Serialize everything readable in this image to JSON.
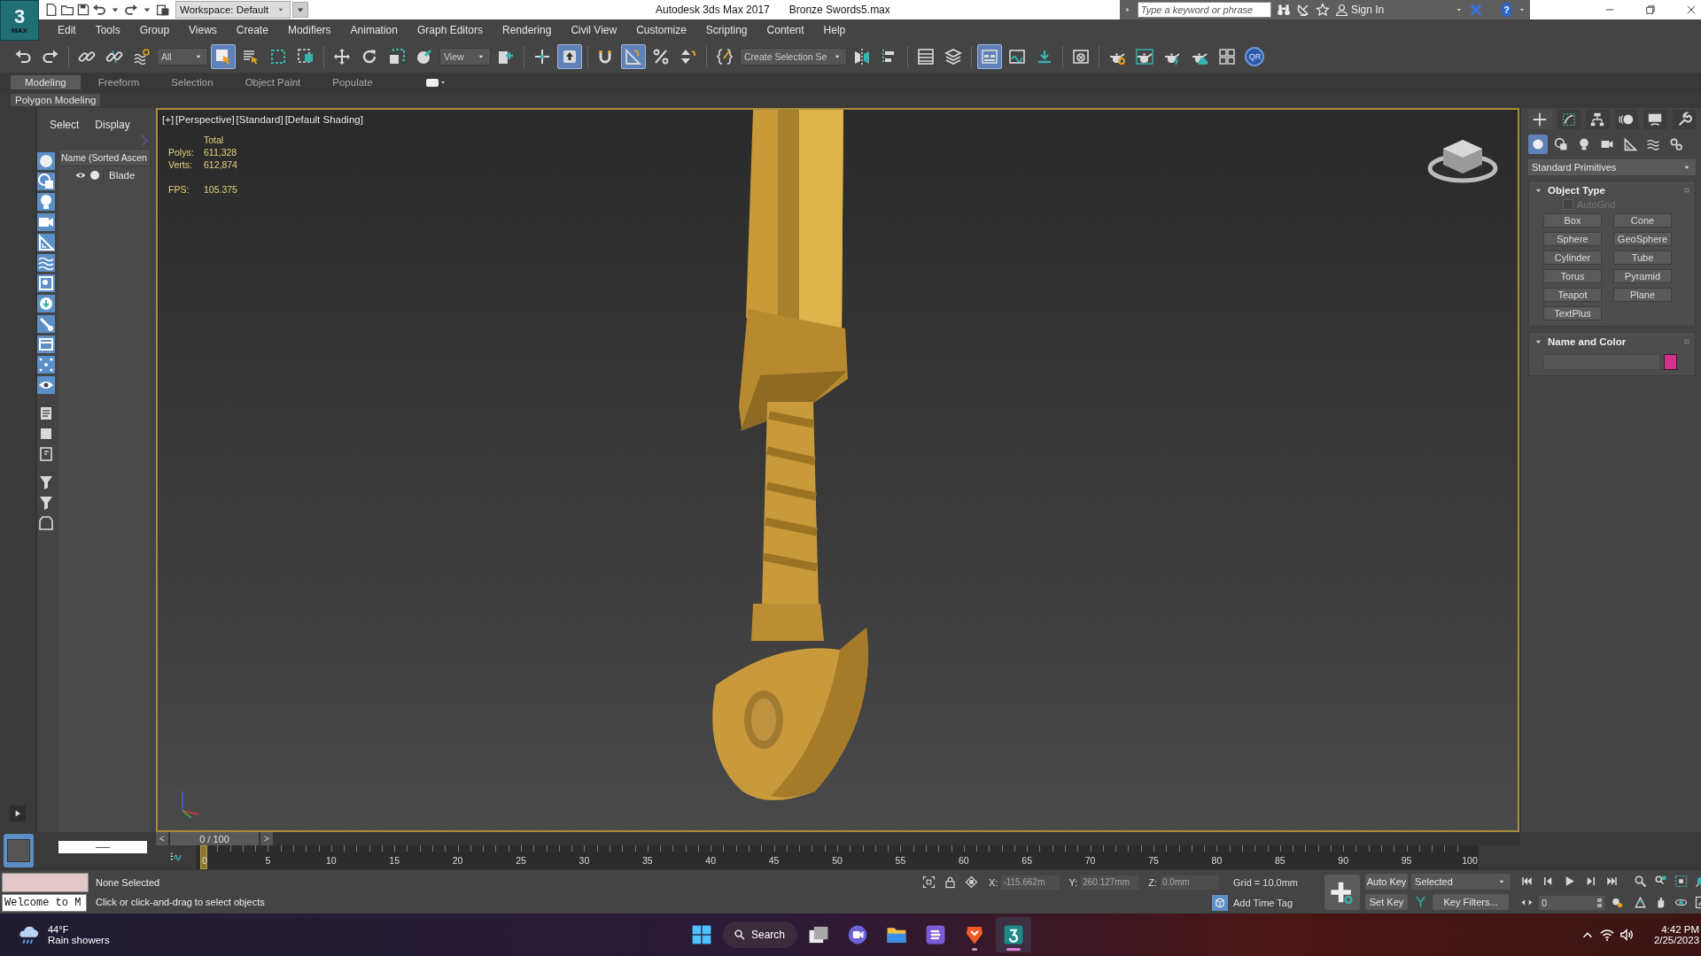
{
  "title_bar": {
    "logo_numeral": "3",
    "logo_label": "MAX",
    "workspace": "Workspace: Default",
    "app_title": "Autodesk 3ds Max 2017",
    "file_name": "Bronze Swords5.max"
  },
  "info_center": {
    "search_placeholder": "Type a keyword or phrase",
    "sign_in": "Sign In",
    "help": "?"
  },
  "menu": [
    "Edit",
    "Tools",
    "Group",
    "Views",
    "Create",
    "Modifiers",
    "Animation",
    "Graph Editors",
    "Rendering",
    "Civil View",
    "Customize",
    "Scripting",
    "Content",
    "Help"
  ],
  "main_toolbar": [
    {
      "kind": "undo",
      "pressed": false
    },
    {
      "kind": "redo",
      "pressed": false
    },
    {
      "kind": "sep"
    },
    {
      "kind": "link",
      "pressed": false
    },
    {
      "kind": "unlink",
      "pressed": false
    },
    {
      "kind": "bind",
      "pressed": false
    },
    {
      "kind": "dropdown",
      "value": "All"
    },
    {
      "kind": "selectobj",
      "pressed": true
    },
    {
      "kind": "selectname",
      "pressed": false
    },
    {
      "kind": "rectregion",
      "pressed": false
    },
    {
      "kind": "window",
      "pressed": false
    },
    {
      "kind": "sep"
    },
    {
      "kind": "move",
      "pressed": false
    },
    {
      "kind": "rotate",
      "pressed": false
    },
    {
      "kind": "scale",
      "pressed": false
    },
    {
      "kind": "place",
      "pressed": false
    },
    {
      "kind": "dropdown",
      "value": "View"
    },
    {
      "kind": "pivot",
      "pressed": false
    },
    {
      "kind": "sep"
    },
    {
      "kind": "manip",
      "pressed": false
    },
    {
      "kind": "uparrow",
      "pressed": true
    },
    {
      "kind": "sep"
    },
    {
      "kind": "snap",
      "pressed": false
    },
    {
      "kind": "angle",
      "pressed": true
    },
    {
      "kind": "percent",
      "pressed": false
    },
    {
      "kind": "spinner",
      "pressed": false
    },
    {
      "kind": "sep"
    },
    {
      "kind": "editsel",
      "pressed": false
    },
    {
      "kind": "dropdown",
      "value": "Create Selection Se"
    },
    {
      "kind": "mirror",
      "pressed": false
    },
    {
      "kind": "align",
      "pressed": false
    },
    {
      "kind": "sep"
    },
    {
      "kind": "sceneexp",
      "pressed": false
    },
    {
      "kind": "layerexp",
      "pressed": false
    },
    {
      "kind": "sep"
    },
    {
      "kind": "ribbon",
      "pressed": true
    },
    {
      "kind": "curve",
      "pressed": false
    },
    {
      "kind": "schematic",
      "pressed": false
    },
    {
      "kind": "sep"
    },
    {
      "kind": "material",
      "pressed": false
    },
    {
      "kind": "sep"
    },
    {
      "kind": "rendersetup",
      "pressed": false
    },
    {
      "kind": "renderframe",
      "pressed": false
    },
    {
      "kind": "render",
      "pressed": false
    },
    {
      "kind": "cloud",
      "pressed": false
    },
    {
      "kind": "a360",
      "pressed": false
    },
    {
      "kind": "qr",
      "label": "QR",
      "pressed": false
    }
  ],
  "ribbon": {
    "tabs": [
      {
        "label": "Modeling",
        "selected": true
      },
      {
        "label": "Freeform",
        "selected": false
      },
      {
        "label": "Selection",
        "selected": false
      },
      {
        "label": "Object Paint",
        "selected": false
      },
      {
        "label": "Populate",
        "selected": false
      }
    ],
    "panel": "Polygon Modeling"
  },
  "scene_explorer": {
    "tabs": [
      "Select",
      "Display"
    ],
    "column": "Name (Sorted Ascen",
    "items": [
      {
        "name": "Blade",
        "visible": true
      }
    ]
  },
  "viewport": {
    "active": true,
    "labels": [
      "[+]",
      "[Perspective]",
      "[Standard]",
      "[Default Shading]"
    ],
    "stats": {
      "header": "Total",
      "rows": [
        {
          "label": "Polys:",
          "value": "611,328"
        },
        {
          "label": "Verts:",
          "value": "612,874"
        }
      ],
      "fps_label": "FPS:",
      "fps": "105.375"
    }
  },
  "command_panel": {
    "tabs": [
      {
        "kind": "create",
        "selected": true
      },
      {
        "kind": "modify",
        "selected": false
      },
      {
        "kind": "hierarchy",
        "selected": false
      },
      {
        "kind": "motion",
        "selected": false
      },
      {
        "kind": "display",
        "selected": false
      },
      {
        "kind": "utilities",
        "selected": false
      }
    ],
    "categories": [
      {
        "kind": "geometry",
        "selected": true
      },
      {
        "kind": "shapes",
        "selected": false
      },
      {
        "kind": "lights",
        "selected": false
      },
      {
        "kind": "cameras",
        "selected": false
      },
      {
        "kind": "helpers",
        "selected": false
      },
      {
        "kind": "spacewarps",
        "selected": false
      },
      {
        "kind": "systems",
        "selected": false
      }
    ],
    "dropdown": "Standard Primitives",
    "object_type": {
      "title": "Object Type",
      "expanded": true,
      "autogrid": {
        "label": "AutoGrid",
        "checked": false,
        "disabled": true
      },
      "buttons": [
        "Box",
        "Cone",
        "Sphere",
        "GeoSphere",
        "Cylinder",
        "Tube",
        "Torus",
        "Pyramid",
        "Teapot",
        "Plane",
        "TextPlus"
      ]
    },
    "name_and_color": {
      "title": "Name and Color",
      "expanded": true,
      "color": "#d4308c"
    }
  },
  "time_slider": {
    "prev": "<",
    "position": "0 / 100",
    "next": ">",
    "level": 0
  },
  "track_bar": {
    "ticks": [
      "0",
      "5",
      "10",
      "15",
      "20",
      "25",
      "30",
      "35",
      "40",
      "45",
      "50",
      "55",
      "60",
      "65",
      "70",
      "75",
      "80",
      "85",
      "90",
      "95",
      "100"
    ]
  },
  "status": {
    "listener_input": "Welcome to M",
    "selection": "None Selected",
    "prompt": "Click or click-and-drag to select objects",
    "coords": [
      {
        "label": "X:",
        "value": "-115.662m"
      },
      {
        "label": "Y:",
        "value": "260.127mm"
      },
      {
        "label": "Z:",
        "value": "0.0mm"
      }
    ],
    "coords_disabled": true,
    "grid": "Grid = 10.0mm",
    "time_tag": "Add Time Tag",
    "auto_key": {
      "label": "Auto Key",
      "on": false
    },
    "key_mode": "Selected",
    "set_key": "Set Key",
    "key_filters": "Key Filters...",
    "frame": "0"
  },
  "taskbar": {
    "weather": {
      "temp": "44°F",
      "text": "Rain showers"
    },
    "search": "Search",
    "apps": [
      {
        "kind": "start",
        "active": false,
        "running": false
      },
      {
        "kind": "taskview",
        "active": false,
        "running": false
      },
      {
        "kind": "chat",
        "active": false,
        "running": false
      },
      {
        "kind": "files",
        "active": false,
        "running": false
      },
      {
        "kind": "notes",
        "active": false,
        "running": false
      },
      {
        "kind": "browser",
        "active": false,
        "running": true
      },
      {
        "kind": "maxapp",
        "active": true,
        "running": true
      }
    ],
    "time": "4:42 PM",
    "date": "2/25/2023"
  }
}
